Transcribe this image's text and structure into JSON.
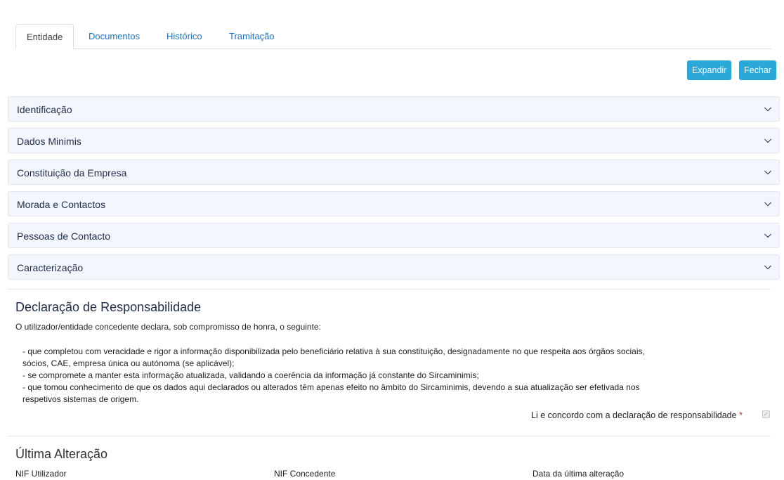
{
  "tabs": [
    "Entidade",
    "Documentos",
    "Histórico",
    "Tramitação"
  ],
  "buttons": {
    "expand": "Expandir",
    "close": "Fechar"
  },
  "sections": [
    "Identificação",
    "Dados Minimis",
    "Constituição da Empresa",
    "Morada e Contactos",
    "Pessoas de Contacto",
    "Caracterização"
  ],
  "declaration": {
    "title": "Declaração de Responsabilidade",
    "intro": "O utilizador/entidade concedente declara, sob compromisso de honra, o seguinte:",
    "line1": "- que completou com veracidade e rigor a informação disponibilizada pelo beneficiário relativa à sua constituição, designadamente no que respeita aos órgãos sociais,",
    "line2": "sócios, CAE, empresa única ou autónoma (se aplicável);",
    "line3": "- se compromete a manter esta informação atualizada, validando a coerência da informação já constante do Sircaminimis;",
    "line4": "- que tomou conhecimento de que os dados aqui declarados ou alterados têm apenas efeito no âmbito do Sircaminimis, devendo a sua atualização ser efetivada nos",
    "line5": "respetivos sistemas de origem.",
    "agree_label": "Li e concordo com a declaração de responsabilidade",
    "required_mark": "*",
    "agree_checked": true
  },
  "last_change": {
    "title": "Última Alteração",
    "fields": [
      "NIF Utilizador",
      "NIF Concedente",
      "Data da última alteração"
    ]
  },
  "icons": {
    "chevron": "chevron-down-icon",
    "check": "check-icon"
  },
  "colors": {
    "button": "#2aa8d8",
    "link": "#1a73c9",
    "accordion_bg": "#f3f6fd",
    "required": "#d62f2f"
  }
}
